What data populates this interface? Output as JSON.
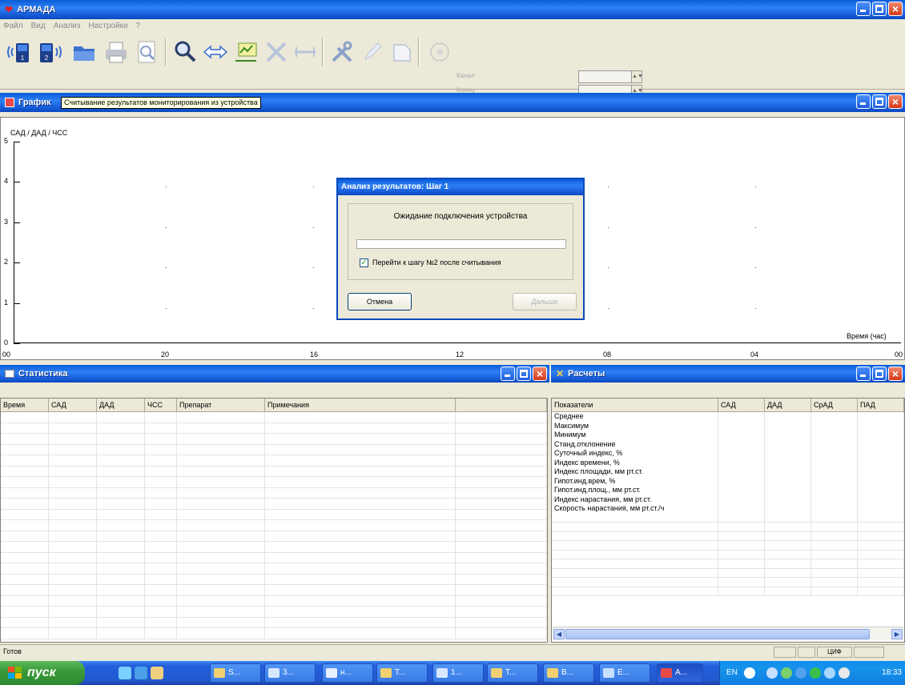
{
  "app": {
    "title": "АРМАДА",
    "menu": [
      "Файл",
      "Вид",
      "Анализ",
      "Настройки",
      "?"
    ]
  },
  "toolbar": {
    "spin1_label": "Канал",
    "spin2_label": "Конец"
  },
  "graph": {
    "title": "График",
    "tooltip": "Считывание результатов мониторирования из устройства",
    "y_label": "САД / ДАД / ЧСС",
    "x_label": "Время (час)",
    "y_ticks": [
      "5",
      "4",
      "3",
      "2",
      "1",
      "0"
    ],
    "x_ticks": [
      "00",
      "20",
      "16",
      "12",
      "08",
      "04",
      "00"
    ]
  },
  "dialog": {
    "title": "Анализ результатов: Шаг 1",
    "message": "Ожидание подключения устройства",
    "progress": 0,
    "checkbox_label": "Перейти к шагу №2 после считывания",
    "checkbox_checked": true,
    "cancel_label": "Отмена",
    "next_label": "Дальше"
  },
  "statistics": {
    "title": "Статистика",
    "columns": [
      "Время",
      "САД",
      "ДАД",
      "ЧСС",
      "Препарат",
      "Примечания"
    ]
  },
  "calculations": {
    "title": "Расчеты",
    "columns": [
      "Показатели",
      "САД",
      "ДАД",
      "СрАД",
      "ПАД"
    ],
    "rows": [
      "Среднее",
      "Максимум",
      "Минимум",
      "Станд.отклонение",
      "Суточный индекс, %",
      "Индекс времени, %",
      "Индекс площади, мм рт.ст.",
      "Гипот.инд.врем, %",
      "Гипот.инд.площ., мм рт.ст.",
      "Индекс нарастания, мм рт.ст.",
      "Скорость нарастания, мм рт.ст./ч"
    ]
  },
  "status": {
    "text": "Готов",
    "indicator": "ЦИФ"
  },
  "taskbar": {
    "start_label": "пуск",
    "tasks": [
      "S...",
      "3...",
      "н...",
      "Т...",
      "1...",
      "Т...",
      "В...",
      "Е...",
      "А..."
    ],
    "lang": "EN",
    "clock": "18:33"
  },
  "colors": {
    "title_blue": "#1b63e0",
    "close_red": "#d4391a",
    "start_green": "#3a9b3a",
    "tooltip_bg": "#ffffe1"
  }
}
